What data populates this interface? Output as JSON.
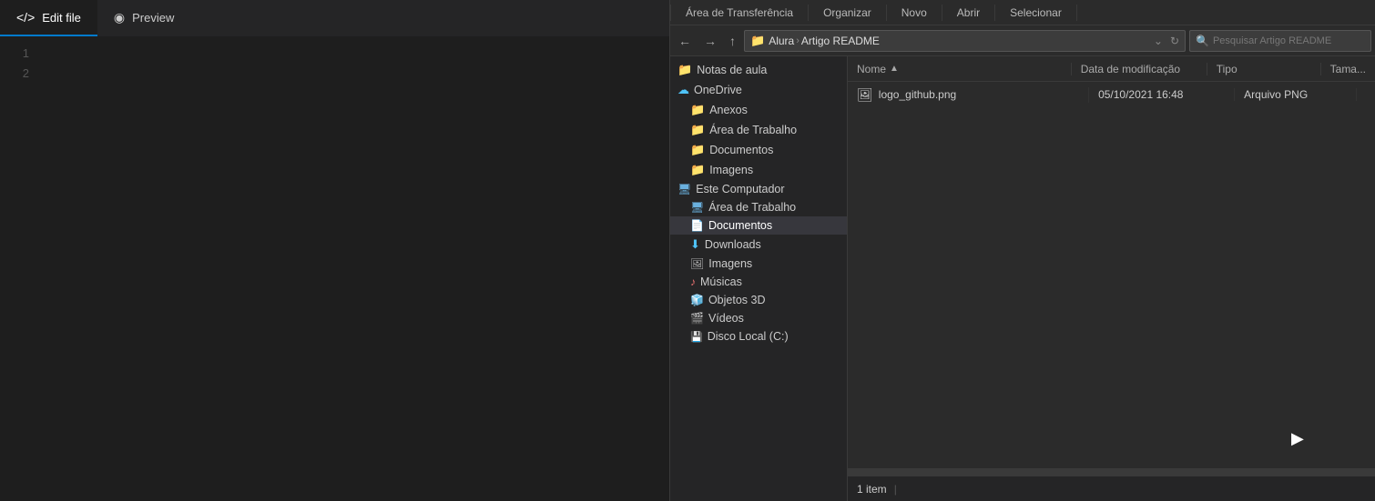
{
  "editor": {
    "tabs": [
      {
        "id": "edit",
        "label": "Edit file",
        "icon": "</>",
        "active": true
      },
      {
        "id": "preview",
        "label": "Preview",
        "icon": "👁",
        "active": false
      }
    ],
    "line_numbers": [
      "1",
      "2"
    ]
  },
  "explorer": {
    "toolbar": {
      "area_de_transferencia": "Área de Transferência",
      "organizar": "Organizar",
      "novo": "Novo",
      "abrir": "Abrir",
      "selecionar": "Selecionar"
    },
    "address": {
      "back_title": "Voltar",
      "forward_title": "Avançar",
      "up_title": "Subir",
      "path": [
        {
          "label": "Alura",
          "icon": "folder"
        },
        {
          "label": "Artigo README"
        }
      ],
      "search_placeholder": "Pesquisar Artigo README"
    },
    "sidebar": {
      "items": [
        {
          "id": "notas-de-aula",
          "label": "Notas de aula",
          "icon": "folder",
          "indent": 0
        },
        {
          "id": "onedrive",
          "label": "OneDrive",
          "icon": "cloud",
          "indent": 0
        },
        {
          "id": "anexos",
          "label": "Anexos",
          "icon": "folder",
          "indent": 1
        },
        {
          "id": "area-de-trabalho",
          "label": "Área de Trabalho",
          "icon": "folder",
          "indent": 1
        },
        {
          "id": "documentos",
          "label": "Documentos",
          "icon": "folder",
          "indent": 1
        },
        {
          "id": "imagens",
          "label": "Imagens",
          "icon": "folder",
          "indent": 1
        },
        {
          "id": "este-computador",
          "label": "Este Computador",
          "icon": "computer",
          "indent": 0
        },
        {
          "id": "area-trabalho-pc",
          "label": "Área de Trabalho",
          "icon": "desktop",
          "indent": 1
        },
        {
          "id": "documentos-pc",
          "label": "Documentos",
          "icon": "docs",
          "indent": 1,
          "selected": true
        },
        {
          "id": "downloads",
          "label": "Downloads",
          "icon": "downloads",
          "indent": 1
        },
        {
          "id": "imagens-pc",
          "label": "Imagens",
          "icon": "images",
          "indent": 1
        },
        {
          "id": "musicas",
          "label": "Músicas",
          "icon": "music",
          "indent": 1
        },
        {
          "id": "objetos-3d",
          "label": "Objetos 3D",
          "icon": "objects",
          "indent": 1
        },
        {
          "id": "videos",
          "label": "Vídeos",
          "icon": "videos",
          "indent": 1
        },
        {
          "id": "disco-local",
          "label": "Disco Local (C:)",
          "icon": "drive",
          "indent": 1
        }
      ]
    },
    "file_list": {
      "headers": [
        {
          "id": "nome",
          "label": "Nome",
          "sort_icon": "▲"
        },
        {
          "id": "data",
          "label": "Data de modificação"
        },
        {
          "id": "tipo",
          "label": "Tipo"
        },
        {
          "id": "tamanho",
          "label": "Tama..."
        }
      ],
      "files": [
        {
          "id": "logo-github",
          "name": "logo_github.png",
          "icon": "🖼",
          "date": "05/10/2021 16:48",
          "type": "Arquivo PNG",
          "size": ""
        }
      ]
    },
    "status_bar": {
      "count": "1 item",
      "separator": "|"
    }
  },
  "colors": {
    "folder": "#e8a000",
    "cloud": "#4fc3f7",
    "selected_bg": "#37373d",
    "accent": "#007acc"
  }
}
